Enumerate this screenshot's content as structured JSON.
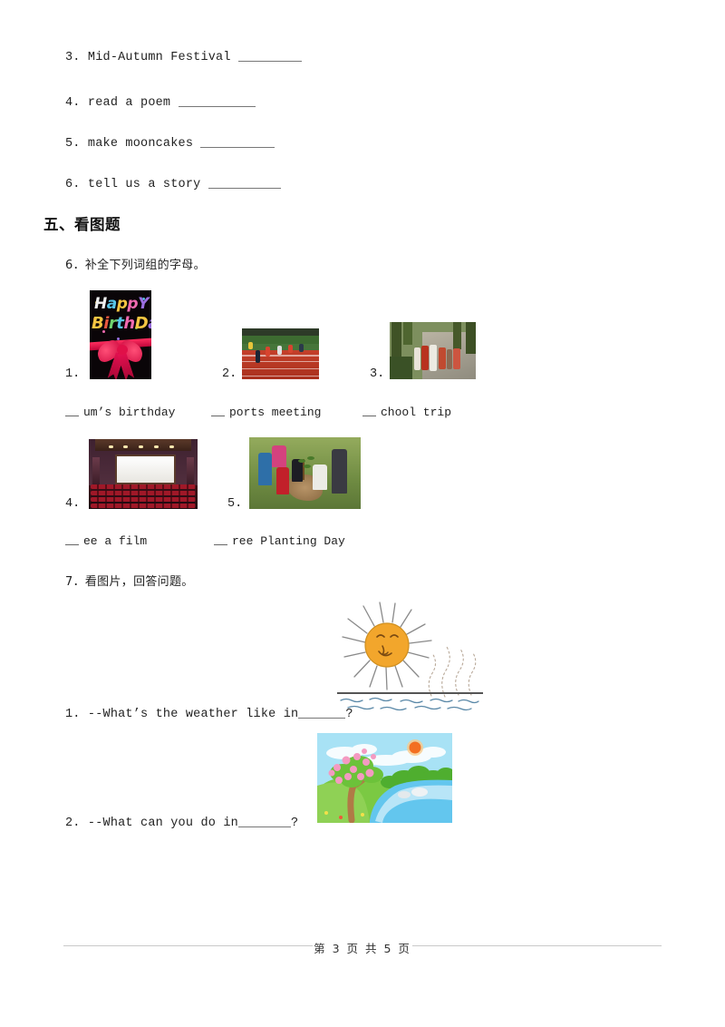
{
  "document": {
    "page_background": "#ffffff"
  },
  "top_questions": [
    {
      "number": "3.",
      "text": "Mid-Autumn Festival",
      "blank_width": 70
    },
    {
      "number": "4.",
      "text": "read a poem",
      "blank_width": 85
    },
    {
      "number": "5.",
      "text": "make mooncakes",
      "blank_width": 82
    },
    {
      "number": "6.",
      "text": "tell us a story",
      "blank_width": 80
    }
  ],
  "section": {
    "heading": "五、看图题"
  },
  "question6": {
    "prompt": "6．补全下列词组的字母。",
    "items": [
      {
        "number": "1.",
        "image": "happy-birthday-card",
        "label": "um’s birthday",
        "answer_blank": true
      },
      {
        "number": "2.",
        "image": "sports-meeting-track",
        "label": "ports meeting",
        "answer_blank": true
      },
      {
        "number": "3.",
        "image": "school-trip-children",
        "label": "chool trip",
        "answer_blank": true
      },
      {
        "number": "4.",
        "image": "cinema-hall",
        "label": "ee a film",
        "answer_blank": true
      },
      {
        "number": "5.",
        "image": "tree-planting",
        "label": "ree Planting Day",
        "answer_blank": true
      }
    ],
    "birthday_card": {
      "line1": "Happy",
      "line2": "BirthDay!",
      "line1_colors": [
        "#f0f0f0",
        "#58c6e8",
        "#f4c542",
        "#f06ab0",
        "#9b6fe0",
        "#6fd36f"
      ],
      "line2_colors": [
        "#f4c542",
        "#e8573f",
        "#6fd36f",
        "#58c6e8",
        "#f06ab0",
        "#f4c542",
        "#9b6fe0",
        "#6fd36f",
        "#e8573f"
      ],
      "background": "#0a0508",
      "ribbon_color": "#e31050"
    }
  },
  "question7": {
    "prompt": "7．看图片，回答问题。",
    "items": [
      {
        "number": "1.",
        "text": "--What’s the weather like in",
        "suffix": "?",
        "image": "hot-sun-over-water"
      },
      {
        "number": "2.",
        "text": "--What can you do in",
        "suffix": "?",
        "image": "spring-scene-blossom-river"
      }
    ],
    "sun_drawing": {
      "sun_color": "#f2a62c",
      "ray_color": "#8a8a8a",
      "water_color": "#5b89a8",
      "ground_line_color": "#555555",
      "steam_color": "#b8a898"
    },
    "spring_drawing": {
      "sky_color": "#a8e2f5",
      "grass_color": "#7bc943",
      "river_color": "#63c6ee",
      "sun_color": "#f36f21",
      "blossom_color": "#f49ac1",
      "tree_trunk_color": "#b07a46"
    }
  },
  "footer": {
    "text": "第 3 页 共 5 页"
  }
}
